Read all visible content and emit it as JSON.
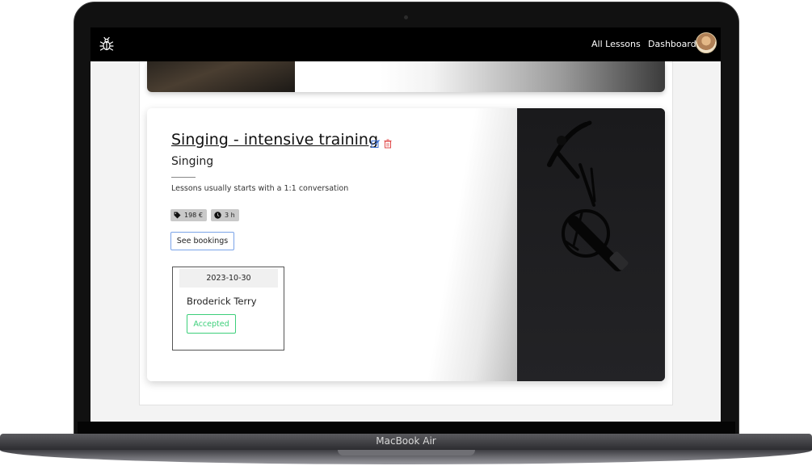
{
  "device": {
    "label": "MacBook Air"
  },
  "navbar": {
    "logo_icon": "bug-icon",
    "links": [
      {
        "label": "All Lessons"
      },
      {
        "label": "Dashboard"
      }
    ],
    "avatar_icon": "user-avatar"
  },
  "lesson": {
    "title": "Singing - intensive training",
    "category": "Singing",
    "description": "Lessons usually starts with a 1:1 conversation",
    "price": "198 €",
    "duration": "3 h",
    "see_bookings_label": "See bookings",
    "edit_icon": "edit-icon",
    "delete_icon": "trash-icon",
    "image": "microphone-image"
  },
  "booking": {
    "date": "2023-10-30",
    "name": "Broderick Terry",
    "status": "Accepted"
  },
  "colors": {
    "accepted": "#3ccf7a",
    "delete": "#e04a4a",
    "edit": "#3b6fd6",
    "outline_button": "#7aa3e8",
    "navbar": "#000000"
  }
}
